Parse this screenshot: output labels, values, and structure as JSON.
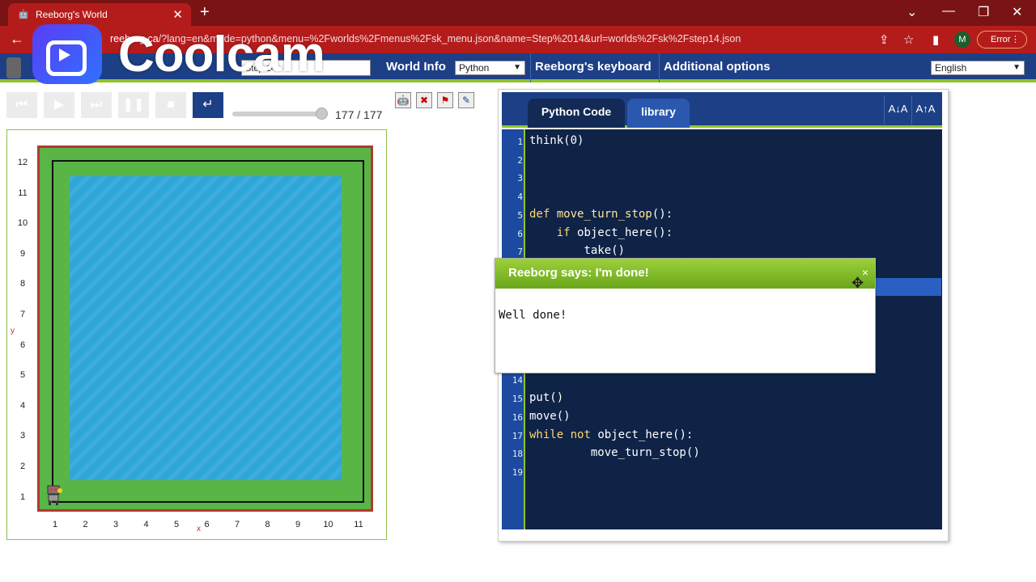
{
  "browser": {
    "tab_title": "Reeborg's World",
    "url_host": "reeborg.ca",
    "url_path": "/?lang=en&mode=python&menu=%2Fworlds%2Fmenus%2Fsk_menu.json&name=Step%2014&url=worlds%2Fsk%2Fstep14.json",
    "profile_initial": "M",
    "error_label": "Error"
  },
  "menubar": {
    "world_name": "Step 14",
    "world_info": "World Info",
    "language_mode": "Python",
    "keyboard": "Reeborg's keyboard",
    "options": "Additional options",
    "ui_language": "English"
  },
  "controls": {
    "step_counter": "177 / 177"
  },
  "world": {
    "y_axis_label": "y",
    "x_axis_label": "x",
    "y_ticks": [
      "12",
      "11",
      "10",
      "9",
      "8",
      "7",
      "6",
      "5",
      "4",
      "3",
      "2",
      "1"
    ],
    "x_ticks": [
      "1",
      "2",
      "3",
      "4",
      "5",
      "6",
      "7",
      "8",
      "9",
      "10",
      "11"
    ],
    "colors": {
      "grass": "#58b546",
      "water": "#2ea6d9",
      "wall": "#b03a2e"
    }
  },
  "editor": {
    "tab_code": "Python Code",
    "tab_library": "library",
    "font_down": "A↓A",
    "font_up": "A↑A",
    "lines": [
      {
        "n": "1",
        "text": "think(0)"
      },
      {
        "n": "2",
        "text": ""
      },
      {
        "n": "3",
        "text": ""
      },
      {
        "n": "4",
        "text": ""
      },
      {
        "n": "5",
        "text": "def move_turn_stop():"
      },
      {
        "n": "6",
        "text": "    if object_here():"
      },
      {
        "n": "7",
        "text": "        take()"
      },
      {
        "n": "14",
        "text": ""
      },
      {
        "n": "15",
        "text": "put()"
      },
      {
        "n": "16",
        "text": "move()"
      },
      {
        "n": "17",
        "text": "while not object_here():"
      },
      {
        "n": "18",
        "text": "         move_turn_stop()"
      },
      {
        "n": "19",
        "text": ""
      }
    ]
  },
  "dialog": {
    "title": "Reeborg says: I'm done!",
    "message": "Well done!",
    "close": "×"
  },
  "watermark": {
    "text": "Coolcam"
  }
}
